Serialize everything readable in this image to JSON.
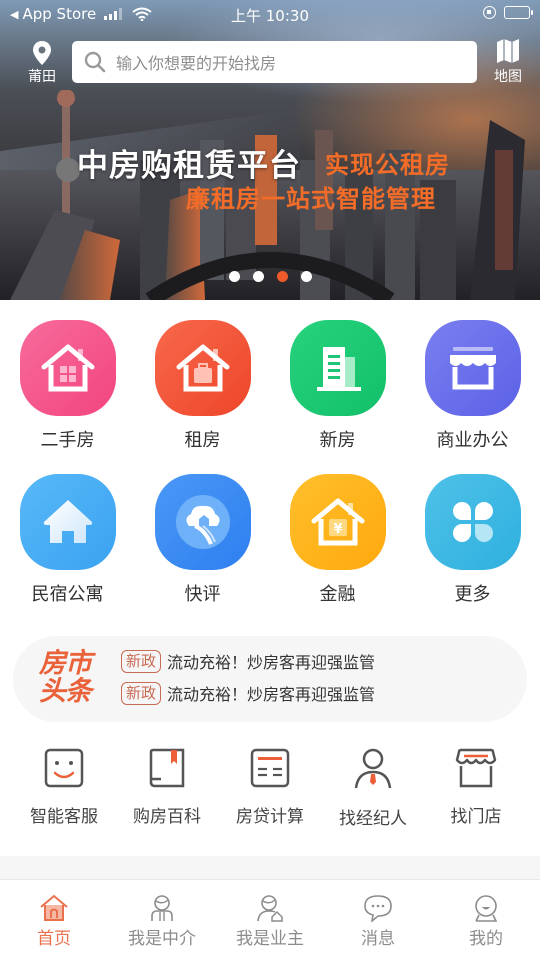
{
  "status_bar": {
    "back_app": "App Store",
    "time": "上午 10:30"
  },
  "top_nav": {
    "location": "莆田",
    "search_placeholder": "输入你想要的开始找房",
    "map_label": "地图"
  },
  "banner": {
    "slogan_main": "中房购租赁平台",
    "slogan_accent_1": "实现公租房",
    "slogan_accent_2": "廉租房一站式智能管理",
    "carousel_count": 4,
    "carousel_active_index": 2,
    "accent_color": "#f36c28"
  },
  "categories": [
    {
      "label": "二手房",
      "icon": "house-window-icon",
      "color_from": "#f86b9c",
      "color_to": "#f2457f"
    },
    {
      "label": "租房",
      "icon": "house-suitcase-icon",
      "color_from": "#f7684c",
      "color_to": "#ee4629"
    },
    {
      "label": "新房",
      "icon": "building-icon",
      "color_from": "#27d27d",
      "color_to": "#13c06a"
    },
    {
      "label": "商业办公",
      "icon": "shop-icon",
      "color_from": "#7a7ff0",
      "color_to": "#5b61e6"
    },
    {
      "label": "民宿公寓",
      "icon": "home-icon",
      "color_from": "#58b9f8",
      "color_to": "#3aa2f1"
    },
    {
      "label": "快评",
      "icon": "cloud-house-icon",
      "color_from": "#4a98f6",
      "color_to": "#2e7ff0"
    },
    {
      "label": "金融",
      "icon": "house-yuan-icon",
      "color_from": "#ffbf2a",
      "color_to": "#ffa90f"
    },
    {
      "label": "更多",
      "icon": "clover-icon",
      "color_from": "#4ec1e8",
      "color_to": "#2fb0df"
    }
  ],
  "news": {
    "logo_line_1": "房市",
    "logo_line_2": "头条",
    "items": [
      {
        "tag": "新政",
        "text": "流动充裕！炒房客再迎强监管"
      },
      {
        "tag": "新政",
        "text": "流动充裕！炒房客再迎强监管"
      }
    ]
  },
  "tools": [
    {
      "label": "智能客服",
      "icon": "smiley-icon"
    },
    {
      "label": "购房百科",
      "icon": "book-icon"
    },
    {
      "label": "房贷计算",
      "icon": "calculator-icon"
    },
    {
      "label": "找经纪人",
      "icon": "agent-icon"
    },
    {
      "label": "找门店",
      "icon": "store-icon"
    }
  ],
  "tabbar": {
    "active_index": 0,
    "tabs": [
      {
        "label": "首页",
        "icon": "home-tab-icon"
      },
      {
        "label": "我是中介",
        "icon": "agent-tab-icon"
      },
      {
        "label": "我是业主",
        "icon": "owner-tab-icon"
      },
      {
        "label": "消息",
        "icon": "message-tab-icon"
      },
      {
        "label": "我的",
        "icon": "profile-tab-icon"
      }
    ],
    "active_color": "#e9714e"
  }
}
